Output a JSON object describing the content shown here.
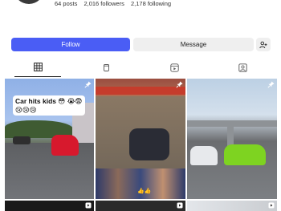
{
  "profile": {
    "posts": "64 posts",
    "followers": "2,016 followers",
    "following": "2,178 following"
  },
  "actions": {
    "follow_label": "Follow",
    "message_label": "Message",
    "add_user_icon": "add-user-icon"
  },
  "tabs": [
    {
      "icon": "grid-icon",
      "active": true
    },
    {
      "icon": "reels-icon",
      "active": false
    },
    {
      "icon": "video-icon",
      "active": false
    },
    {
      "icon": "tagged-icon",
      "active": false
    }
  ],
  "posts": [
    {
      "caption": "Car hits kids 😳 😭😨 😢😢😢",
      "pinned": true
    },
    {
      "pinned": true,
      "overlay": "👍👍"
    },
    {
      "pinned": true
    }
  ],
  "colors": {
    "follow_button": "#4a5df5",
    "secondary_button": "#efefef"
  }
}
